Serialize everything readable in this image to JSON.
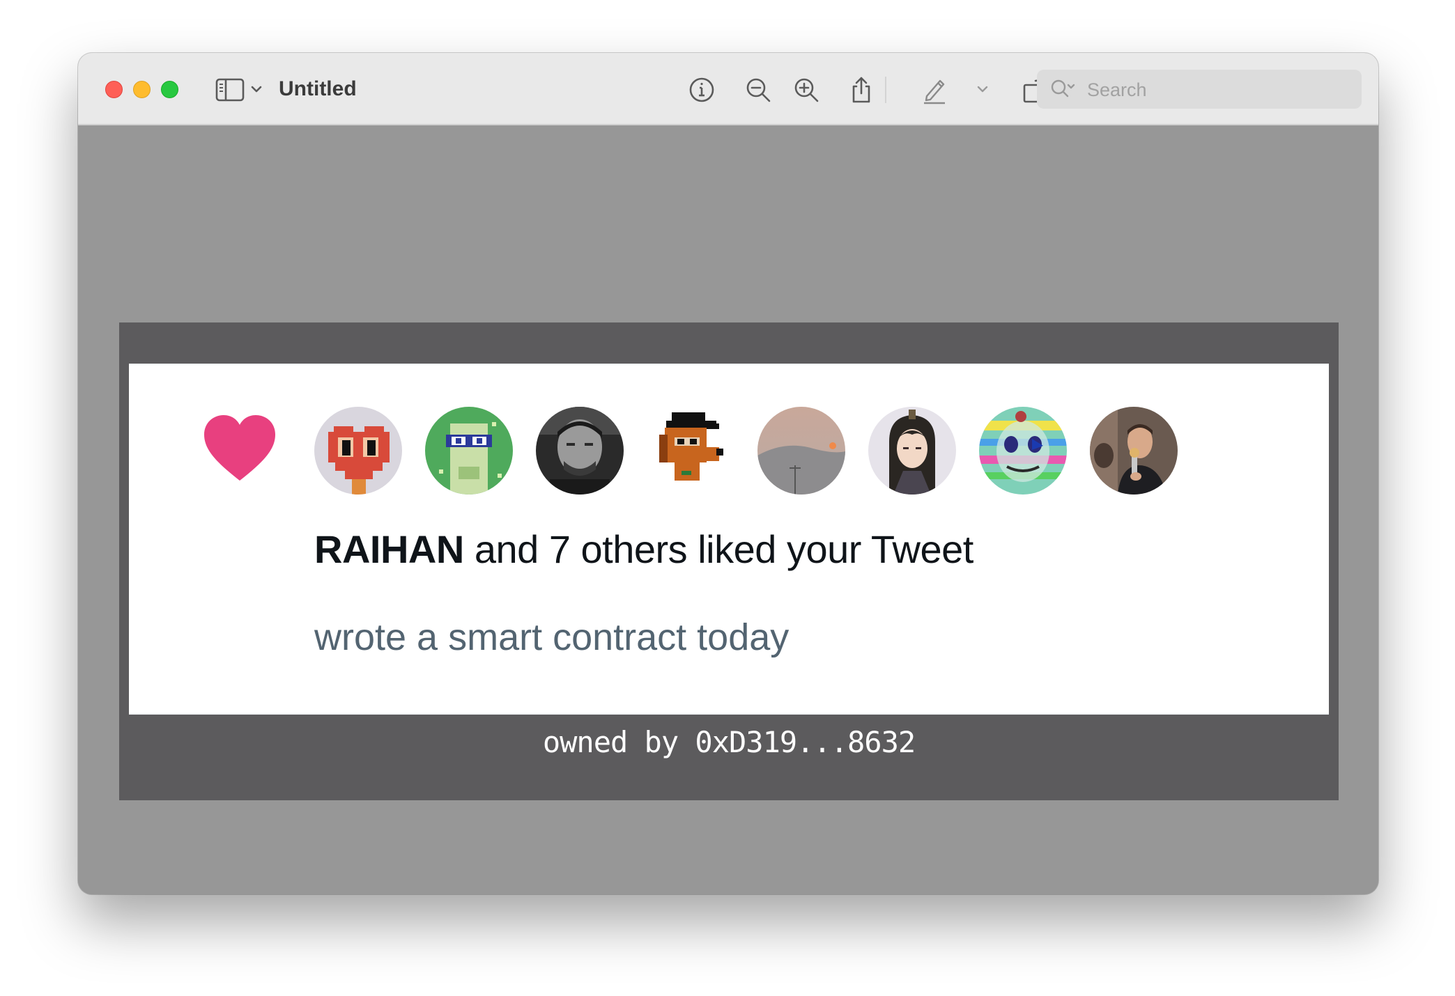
{
  "window": {
    "title": "Untitled"
  },
  "toolbar": {
    "icons": [
      "sidebar-toggle-icon",
      "chevron-down-icon",
      "info-icon",
      "zoom-out-icon",
      "zoom-in-icon",
      "share-icon",
      "markup-pencil-icon",
      "markup-menu-chevron-icon",
      "rotate-icon",
      "annotate-icon",
      "search-icon"
    ],
    "search_placeholder": "Search"
  },
  "card": {
    "heart_color": "#e8407f",
    "avatars": [
      {
        "icon": "pixel-heart-avatar"
      },
      {
        "icon": "pixel-nerd-avatar"
      },
      {
        "icon": "man-photo-avatar"
      },
      {
        "icon": "pixel-dog-avatar"
      },
      {
        "icon": "sunset-landscape-avatar"
      },
      {
        "icon": "anime-character-avatar"
      },
      {
        "icon": "glitch-art-avatar"
      },
      {
        "icon": "man-with-microphone-avatar"
      }
    ],
    "liker_name": "RAIHAN",
    "like_suffix": " and 7 others liked your Tweet",
    "tweet_text": "wrote a smart contract today"
  },
  "owner_text": "owned by 0xD319...8632",
  "colors": {
    "frame": "#5c5b5d",
    "window_bg": "#979797",
    "tweet_text": "#536471"
  }
}
